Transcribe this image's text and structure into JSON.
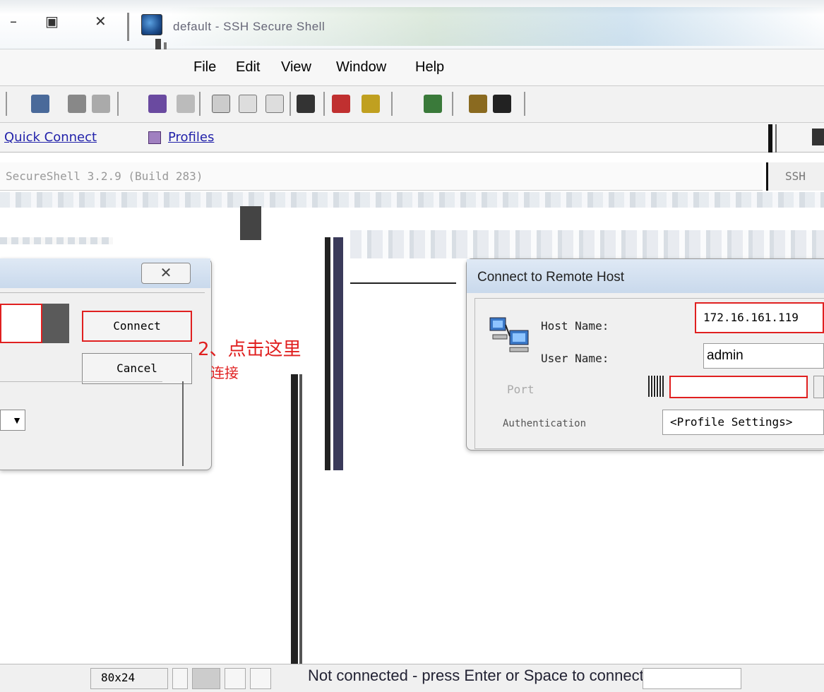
{
  "window": {
    "title": "default - SSH Secure Shell",
    "system_buttons": [
      "–",
      "▣",
      "✕"
    ]
  },
  "menu": {
    "file": "File",
    "edit": "Edit",
    "view": "View",
    "window": "Window",
    "help": "Help"
  },
  "quickbar": {
    "quick_connect": "Quick Connect",
    "profiles": "Profiles"
  },
  "session": {
    "tab_label": "SecureShell 3.2.9 (Build 283)",
    "right_tab_label": "SSH"
  },
  "left_dialog": {
    "close_glyph": "✕",
    "connect_label": "Connect",
    "cancel_label": "Cancel",
    "dropdown_glyph": "▼"
  },
  "annotation": {
    "line1": "2、点击这里",
    "line2": "连接"
  },
  "connect_dialog": {
    "title": "Connect to Remote Host",
    "host_label": "Host Name:",
    "host_value": "172.16.161.119",
    "user_label": "User Name:",
    "user_value": "admin",
    "port_label": "Port",
    "auth_label": "Authentication",
    "auth_value": "<Profile Settings>"
  },
  "status": {
    "size": "80x24",
    "message": "Not connected - press Enter or Space to connect"
  },
  "colors": {
    "annotation_red": "#e02020",
    "dialog_bg": "#f0f0f0",
    "title_gradient_top": "#dfe9f5"
  }
}
